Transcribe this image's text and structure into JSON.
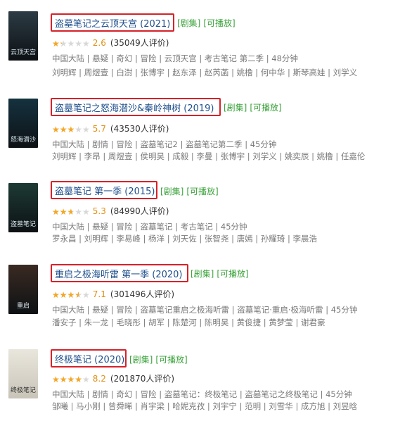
{
  "items": [
    {
      "title": "盗墓笔记之云顶天宫 (2021)",
      "tag1": "[剧集]",
      "tag2": "[可播放]",
      "score": "2.6",
      "votes": "(35049人评价)",
      "rating_fraction": 0.26,
      "meta1": "中国大陆 | 悬疑 | 奇幻 | 冒险 | 云顶天宫 | 考古笔记 第二季 | 48分钟",
      "meta2": "刘明辉 | 周煜壹 | 白澍 | 张博宇 | 赵东泽 | 赵芮菡 | 姚橹 | 何中华 | 斯琴高娃 | 刘学义",
      "poster_text": "云顶天宫",
      "poster_color": "#2c3b44"
    },
    {
      "title": "盗墓笔记之怒海潜沙&秦岭神树 (2019)",
      "tag1": "[剧集]",
      "tag2": "[可播放]",
      "score": "5.7",
      "votes": "(43530人评价)",
      "rating_fraction": 0.57,
      "meta1": "中国大陆 | 剧情 | 冒险 | 盗墓笔记2 | 盗墓笔记第二季 | 45分钟",
      "meta2": "刘明辉 | 李昂 | 周煜壹 | 侯明昊 | 成毅 | 李曼 | 张博宇 | 刘学义 | 姚奕辰 | 姚橹 | 任嘉伦",
      "poster_text": "怒海潜沙",
      "poster_color": "#15323f"
    },
    {
      "title": "盗墓笔记 第一季 (2015)",
      "tag1": "[剧集]",
      "tag2": "[可播放]",
      "score": "5.3",
      "votes": "(84990人评价)",
      "rating_fraction": 0.53,
      "meta1": "中国大陆 | 悬疑 | 冒险 | 盗墓笔记 | 考古笔记 | 45分钟",
      "meta2": "罗永昌 | 刘明辉 | 李易峰 | 杨洋 | 刘天佐 | 张智尧 | 唐嫣 | 孙耀琦 | 李晨浩",
      "poster_text": "盗墓笔记",
      "poster_color": "#1d3a34"
    },
    {
      "title": "重启之极海听雷 第一季 (2020)",
      "tag1": "[剧集]",
      "tag2": "[可播放]",
      "score": "7.1",
      "votes": "(301496人评价)",
      "rating_fraction": 0.71,
      "meta1": "中国大陆 | 悬疑 | 冒险 | 盗墓笔记重启之极海听雷 | 盗墓笔记·重启·极海听雷 | 45分钟",
      "meta2": "潘安子 | 朱一龙 | 毛晓彤 | 胡军 | 陈楚河 | 陈明昊 | 黄俊捷 | 黄梦莹 | 谢君豪",
      "poster_text": "重启",
      "poster_color": "#3a2a22"
    },
    {
      "title": "终极笔记 (2020)",
      "tag1": "[剧集]",
      "tag2": "[可播放]",
      "score": "8.2",
      "votes": "(201870人评价)",
      "rating_fraction": 0.82,
      "meta1": "中国大陆 | 剧情 | 奇幻 | 冒险 | 盗墓笔记：终极笔记 | 盗墓笔记之终极笔记 | 45分钟",
      "meta2": "邹曦 | 马小刚 | 曾舜晞 | 肖宇梁 | 哈妮克孜 | 刘宇宁 | 范明 | 刘雪华 | 成方旭 | 刘昱晗",
      "poster_text": "终极笔记",
      "poster_color": "#c9c4b8"
    }
  ]
}
